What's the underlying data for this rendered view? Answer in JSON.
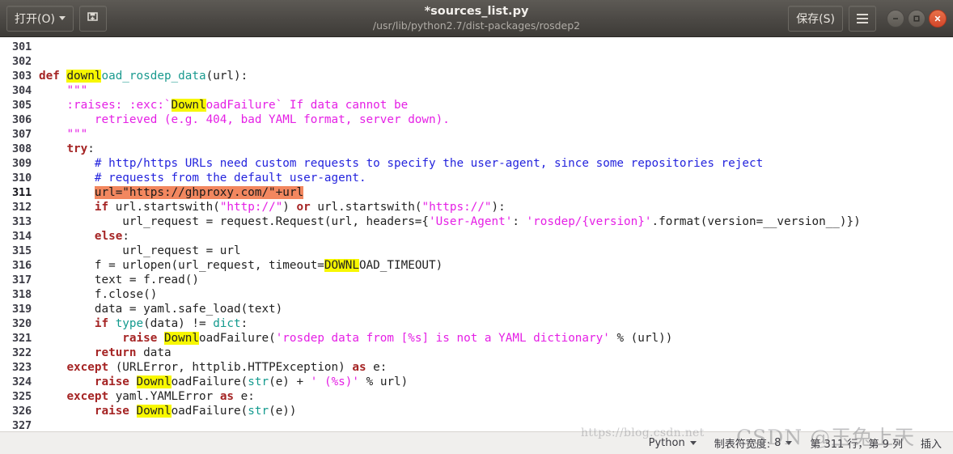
{
  "titlebar": {
    "open_button": "打开(O)",
    "save_as_icon": "save-as-icon",
    "title": "*sources_list.py",
    "subtitle": "/usr/lib/python2.7/dist-packages/rosdep2",
    "save_button": "保存(S)",
    "menu_icon": "hamburger-menu-icon",
    "window_controls": {
      "minimize": "minimize-icon",
      "maximize": "maximize-icon",
      "close": "close-icon"
    }
  },
  "editor": {
    "search_term": "downl",
    "selection_line": 311,
    "lines": [
      {
        "num": "301",
        "tokens": []
      },
      {
        "num": "302",
        "tokens": []
      },
      {
        "num": "303",
        "tokens": [
          {
            "t": "def",
            "c": "kw"
          },
          {
            "t": " ",
            "c": "op"
          },
          {
            "t": "downl",
            "c": "fn hl"
          },
          {
            "t": "oad_rosdep_data",
            "c": "fn"
          },
          {
            "t": "(url):",
            "c": "op"
          }
        ]
      },
      {
        "num": "304",
        "tokens": [
          {
            "t": "    ",
            "c": "op"
          },
          {
            "t": "\"\"\"",
            "c": "str"
          }
        ]
      },
      {
        "num": "305",
        "tokens": [
          {
            "t": "    :raises: :exc:`",
            "c": "str"
          },
          {
            "t": "Downl",
            "c": "str hl"
          },
          {
            "t": "oadFailure` If data cannot be",
            "c": "str"
          }
        ]
      },
      {
        "num": "306",
        "tokens": [
          {
            "t": "        retrieved (e.g. 404, bad YAML format, server down).",
            "c": "str"
          }
        ]
      },
      {
        "num": "307",
        "tokens": [
          {
            "t": "    ",
            "c": "op"
          },
          {
            "t": "\"\"\"",
            "c": "str"
          }
        ]
      },
      {
        "num": "308",
        "tokens": [
          {
            "t": "    ",
            "c": "op"
          },
          {
            "t": "try",
            "c": "kw"
          },
          {
            "t": ":",
            "c": "op"
          }
        ]
      },
      {
        "num": "309",
        "tokens": [
          {
            "t": "        ",
            "c": "op"
          },
          {
            "t": "# http/https URLs need custom requests to specify the user-agent, since some repositories reject",
            "c": "cmt"
          }
        ]
      },
      {
        "num": "310",
        "tokens": [
          {
            "t": "        ",
            "c": "op"
          },
          {
            "t": "# requests from the default user-agent.",
            "c": "cmt"
          }
        ]
      },
      {
        "num": "311",
        "cur": true,
        "tokens": [
          {
            "t": "        ",
            "c": "op"
          },
          {
            "t": "url=\"https://ghproxy.com/\"+url",
            "c": "sel"
          }
        ]
      },
      {
        "num": "312",
        "tokens": [
          {
            "t": "        ",
            "c": "op"
          },
          {
            "t": "if",
            "c": "kw"
          },
          {
            "t": " url.startswith(",
            "c": "op"
          },
          {
            "t": "\"http://\"",
            "c": "str"
          },
          {
            "t": ") ",
            "c": "op"
          },
          {
            "t": "or",
            "c": "kw"
          },
          {
            "t": " url.startswith(",
            "c": "op"
          },
          {
            "t": "\"https://\"",
            "c": "str"
          },
          {
            "t": "):",
            "c": "op"
          }
        ]
      },
      {
        "num": "313",
        "tokens": [
          {
            "t": "            url_request = request.Request(url, headers={",
            "c": "op"
          },
          {
            "t": "'User-Agent'",
            "c": "str"
          },
          {
            "t": ": ",
            "c": "op"
          },
          {
            "t": "'rosdep/{version}'",
            "c": "str"
          },
          {
            "t": ".format(version=__version__)})",
            "c": "op"
          }
        ]
      },
      {
        "num": "314",
        "tokens": [
          {
            "t": "        ",
            "c": "op"
          },
          {
            "t": "else",
            "c": "kw"
          },
          {
            "t": ":",
            "c": "op"
          }
        ]
      },
      {
        "num": "315",
        "tokens": [
          {
            "t": "            url_request = url",
            "c": "op"
          }
        ]
      },
      {
        "num": "316",
        "tokens": [
          {
            "t": "        f = urlopen(url_request, timeout=",
            "c": "op"
          },
          {
            "t": "DOWNL",
            "c": "op hl"
          },
          {
            "t": "OAD_TIMEOUT)",
            "c": "op"
          }
        ]
      },
      {
        "num": "317",
        "tokens": [
          {
            "t": "        text = f.read()",
            "c": "op"
          }
        ]
      },
      {
        "num": "318",
        "tokens": [
          {
            "t": "        f.close()",
            "c": "op"
          }
        ]
      },
      {
        "num": "319",
        "tokens": [
          {
            "t": "        data = yaml.safe_load(text)",
            "c": "op"
          }
        ]
      },
      {
        "num": "320",
        "tokens": [
          {
            "t": "        ",
            "c": "op"
          },
          {
            "t": "if",
            "c": "kw"
          },
          {
            "t": " ",
            "c": "op"
          },
          {
            "t": "type",
            "c": "bi"
          },
          {
            "t": "(data) != ",
            "c": "op"
          },
          {
            "t": "dict",
            "c": "bi"
          },
          {
            "t": ":",
            "c": "op"
          }
        ]
      },
      {
        "num": "321",
        "tokens": [
          {
            "t": "            ",
            "c": "op"
          },
          {
            "t": "raise",
            "c": "kw"
          },
          {
            "t": " ",
            "c": "op"
          },
          {
            "t": "Downl",
            "c": "op hl"
          },
          {
            "t": "oadFailure(",
            "c": "op"
          },
          {
            "t": "'rosdep data from [%s] is not a YAML dictionary'",
            "c": "str"
          },
          {
            "t": " % (url))",
            "c": "op"
          }
        ]
      },
      {
        "num": "322",
        "tokens": [
          {
            "t": "        ",
            "c": "op"
          },
          {
            "t": "return",
            "c": "kw"
          },
          {
            "t": " data",
            "c": "op"
          }
        ]
      },
      {
        "num": "323",
        "tokens": [
          {
            "t": "    ",
            "c": "op"
          },
          {
            "t": "except",
            "c": "kw"
          },
          {
            "t": " (URLError, httplib.HTTPException) ",
            "c": "op"
          },
          {
            "t": "as",
            "c": "kw"
          },
          {
            "t": " e:",
            "c": "op"
          }
        ]
      },
      {
        "num": "324",
        "tokens": [
          {
            "t": "        ",
            "c": "op"
          },
          {
            "t": "raise",
            "c": "kw"
          },
          {
            "t": " ",
            "c": "op"
          },
          {
            "t": "Downl",
            "c": "op hl"
          },
          {
            "t": "oadFailure(",
            "c": "op"
          },
          {
            "t": "str",
            "c": "bi"
          },
          {
            "t": "(e) + ",
            "c": "op"
          },
          {
            "t": "' (%s)'",
            "c": "str"
          },
          {
            "t": " % url)",
            "c": "op"
          }
        ]
      },
      {
        "num": "325",
        "tokens": [
          {
            "t": "    ",
            "c": "op"
          },
          {
            "t": "except",
            "c": "kw"
          },
          {
            "t": " yaml.YAMLError ",
            "c": "op"
          },
          {
            "t": "as",
            "c": "kw"
          },
          {
            "t": " e:",
            "c": "op"
          }
        ]
      },
      {
        "num": "326",
        "tokens": [
          {
            "t": "        ",
            "c": "op"
          },
          {
            "t": "raise",
            "c": "kw"
          },
          {
            "t": " ",
            "c": "op"
          },
          {
            "t": "Downl",
            "c": "op hl"
          },
          {
            "t": "oadFailure(",
            "c": "op"
          },
          {
            "t": "str",
            "c": "bi"
          },
          {
            "t": "(e))",
            "c": "op"
          }
        ]
      },
      {
        "num": "327",
        "tokens": []
      }
    ]
  },
  "statusbar": {
    "language": "Python",
    "tab_width_label": "制表符宽度:",
    "tab_width_value": "8",
    "cursor_position": "第 311 行，第 9 列",
    "insert_mode": "插入"
  },
  "watermark": {
    "url": "https://blog.csdn.net",
    "brand": "CSDN @玉兔上天"
  }
}
